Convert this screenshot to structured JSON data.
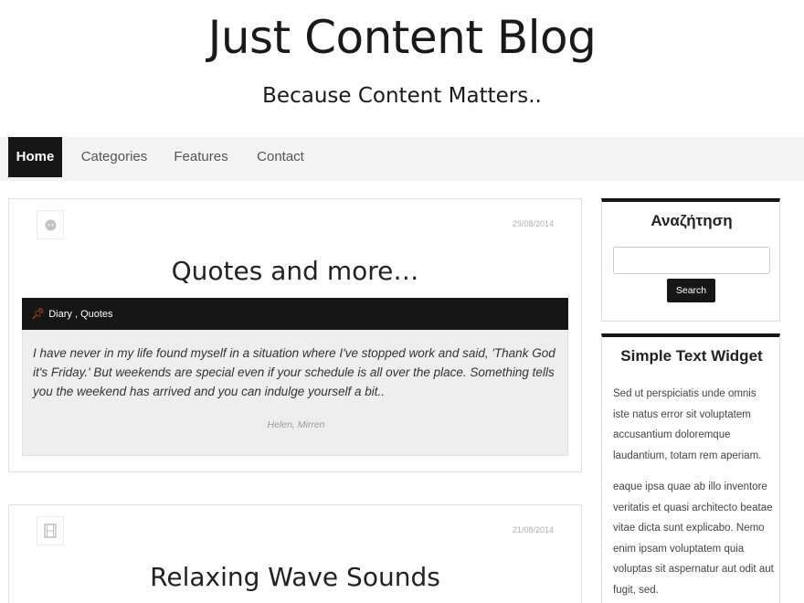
{
  "site": {
    "title": "Just Content Blog",
    "tagline": "Because Content Matters.."
  },
  "nav": {
    "items": [
      {
        "label": "Home",
        "active": true
      },
      {
        "label": "Categories",
        "active": false
      },
      {
        "label": "Features",
        "active": false
      },
      {
        "label": "Contact",
        "active": false
      }
    ]
  },
  "posts": [
    {
      "format_icon": "quote-format-icon",
      "date": "29/08/2014",
      "title": "Quotes and more…",
      "categories": "Diary , Quotes",
      "quote": "I have never in my life found myself in a situation where I've stopped work and said, 'Thank God it's Friday.' But weekends are special even if your schedule is all over the place. Something tells you the weekend has arrived and you can indulge yourself a bit..",
      "quote_author": "Helen, Mirren"
    },
    {
      "format_icon": "video-format-icon",
      "date": "21/08/2014",
      "title": "Relaxing Wave Sounds"
    }
  ],
  "sidebar": {
    "search": {
      "title": "Αναζήτηση",
      "placeholder": "",
      "button_label": "Search"
    },
    "text_widget": {
      "title": "Simple Text Widget",
      "paragraph1": "Sed ut perspiciatis unde omnis iste natus error sit voluptatem accusantium doloremque laudantium, totam rem aperiam.",
      "paragraph2": "eaque ipsa quae ab illo inventore veritatis et quasi architecto beatae vitae dicta sunt explicabo. Nemo enim ipsam voluptatem quia voluptas sit aspernatur aut odit aut fugit, sed."
    }
  },
  "colors": {
    "accent": "#161616",
    "pin": "#e8561b",
    "nav_bg": "#f3f3f3",
    "quote_bg": "#eeeeee"
  }
}
